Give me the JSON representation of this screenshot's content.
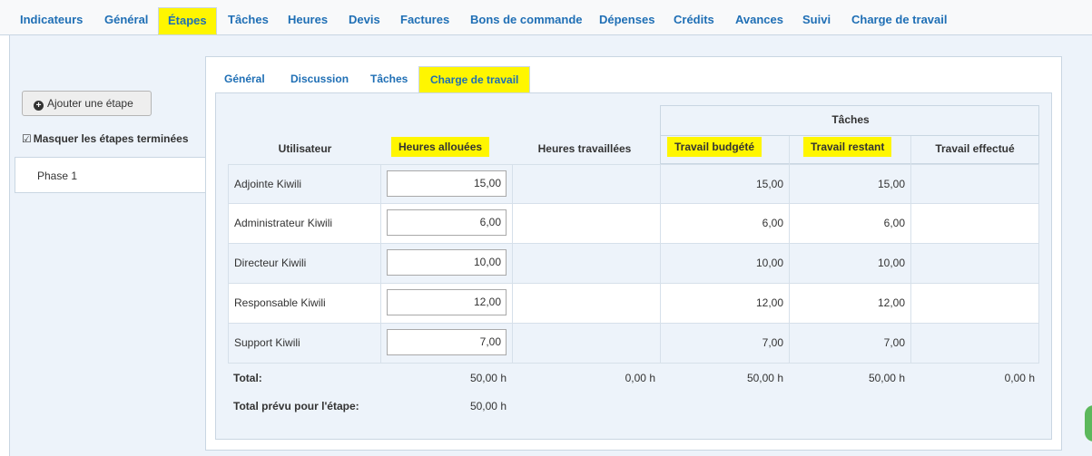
{
  "top_tabs": [
    {
      "label": "Indicateurs"
    },
    {
      "label": "Général"
    },
    {
      "label": "Étapes",
      "active": true
    },
    {
      "label": "Tâches"
    },
    {
      "label": "Heures"
    },
    {
      "label": "Devis"
    },
    {
      "label": "Factures"
    },
    {
      "label": "Bons de commande"
    },
    {
      "label": "Dépenses"
    },
    {
      "label": "Crédits"
    },
    {
      "label": "Avances"
    },
    {
      "label": "Suivi"
    },
    {
      "label": "Charge de travail"
    }
  ],
  "sidebar": {
    "add_step_label": "Ajouter une étape",
    "hide_done_label": "Masquer les étapes terminées",
    "phases": [
      {
        "label": "Phase 1"
      }
    ]
  },
  "inner_tabs": [
    {
      "label": "Général"
    },
    {
      "label": "Discussion"
    },
    {
      "label": "Tâches"
    },
    {
      "label": "Charge de travail",
      "active": true
    }
  ],
  "table": {
    "group_header": "Tâches",
    "columns": {
      "user": "Utilisateur",
      "allocated": "Heures allouées",
      "worked": "Heures travaillées",
      "budgeted": "Travail budgété",
      "remaining": "Travail restant",
      "done": "Travail effectué"
    },
    "rows": [
      {
        "user": "Adjointe Kiwili",
        "allocated": "15,00",
        "worked": "",
        "budgeted": "15,00",
        "remaining": "15,00",
        "done": ""
      },
      {
        "user": "Administrateur Kiwili",
        "allocated": "6,00",
        "worked": "",
        "budgeted": "6,00",
        "remaining": "6,00",
        "done": ""
      },
      {
        "user": "Directeur Kiwili",
        "allocated": "10,00",
        "worked": "",
        "budgeted": "10,00",
        "remaining": "10,00",
        "done": ""
      },
      {
        "user": "Responsable Kiwili",
        "allocated": "12,00",
        "worked": "",
        "budgeted": "12,00",
        "remaining": "12,00",
        "done": ""
      },
      {
        "user": "Support Kiwili",
        "allocated": "7,00",
        "worked": "",
        "budgeted": "7,00",
        "remaining": "7,00",
        "done": ""
      }
    ],
    "total": {
      "label": "Total:",
      "allocated": "50,00 h",
      "worked": "0,00 h",
      "budgeted": "50,00 h",
      "remaining": "50,00 h",
      "done": "0,00 h"
    },
    "planned": {
      "label": "Total prévu pour l'étape:",
      "allocated": "50,00 h"
    }
  },
  "colors": {
    "highlight": "#fff600",
    "link": "#1f6fb5",
    "panel_bg": "#edf3fa",
    "border": "#c9d6e2"
  }
}
